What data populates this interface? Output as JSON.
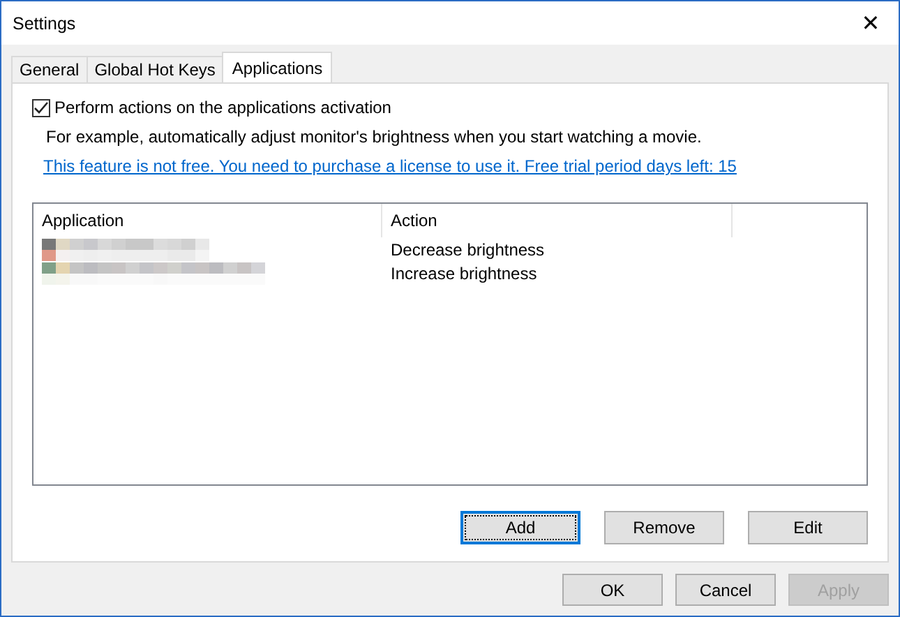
{
  "window": {
    "title": "Settings",
    "close": "✕"
  },
  "tabs": [
    {
      "label": "General",
      "selected": false
    },
    {
      "label": "Global Hot Keys",
      "selected": false
    },
    {
      "label": "Applications",
      "selected": true
    }
  ],
  "activation": {
    "label": "Perform actions on the applications activation",
    "checked": true
  },
  "description": "For example, automatically adjust monitor's brightness when you start watching a movie.",
  "license_link": "This feature is not free. You need to purchase a license to use it. Free trial period days left: 15",
  "table": {
    "columns": [
      "Application",
      "Action"
    ],
    "rows": [
      {
        "application": {
          "kind": "pixelated"
        },
        "action": "Decrease brightness"
      },
      {
        "application": {
          "kind": "pixelated"
        },
        "action": "Increase brightness"
      }
    ]
  },
  "list_buttons": [
    {
      "label": "Add",
      "focused": true,
      "disabled": false
    },
    {
      "label": "Remove",
      "focused": false,
      "disabled": false
    },
    {
      "label": "Edit",
      "focused": false,
      "disabled": false
    }
  ],
  "dialog_buttons": [
    {
      "label": "OK",
      "focused": false,
      "disabled": false
    },
    {
      "label": "Cancel",
      "focused": false,
      "disabled": false
    },
    {
      "label": "Apply",
      "focused": false,
      "disabled": true
    }
  ]
}
